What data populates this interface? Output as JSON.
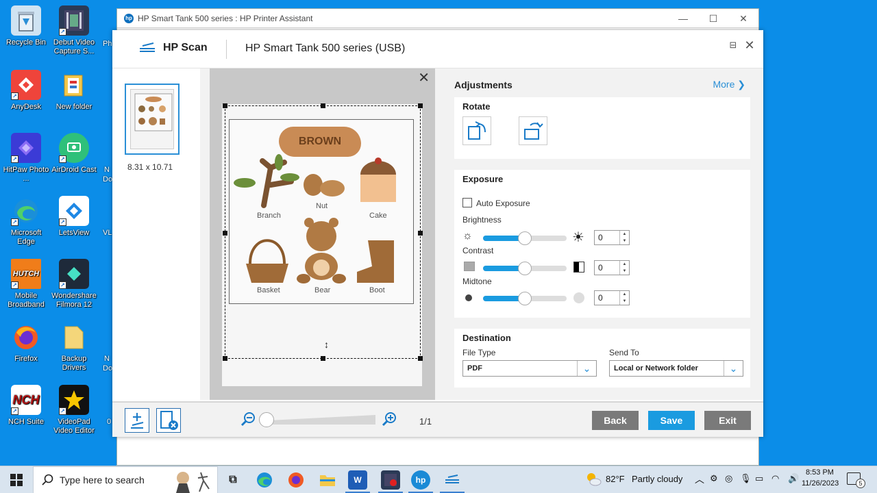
{
  "desktop": {
    "icons": [
      {
        "label": "Recycle Bin",
        "icon": "recycle-bin-icon",
        "color": "#cfe3f2"
      },
      {
        "label": "Debut Video Capture S...",
        "icon": "debut-video-icon",
        "color": "#2b3a56"
      },
      {
        "label": "AnyDesk",
        "icon": "anydesk-icon",
        "color": "#ef443b"
      },
      {
        "label": "New folder",
        "icon": "folder-icon",
        "color": "#f4c84a"
      },
      {
        "label": "HitPaw Photo ...",
        "icon": "hitpaw-icon",
        "color": "#3b3bd6"
      },
      {
        "label": "AirDroid Cast",
        "icon": "airdroid-cast-icon",
        "color": "#2fc07a"
      },
      {
        "label": "Microsoft Edge",
        "icon": "edge-icon",
        "color": "#1b8fd8"
      },
      {
        "label": "LetsView",
        "icon": "letsview-icon",
        "color": "#ffffff"
      },
      {
        "label": "Mobile Broadband",
        "icon": "hutch-icon",
        "color": "#f07d1a"
      },
      {
        "label": "Wondershare Filmora 12",
        "icon": "filmora-icon",
        "color": "#1e2a3a"
      },
      {
        "label": "Firefox",
        "icon": "firefox-icon",
        "color": "#f05a24"
      },
      {
        "label": "Backup Drivers",
        "icon": "folder-icon",
        "color": "#f4d67a"
      },
      {
        "label": "NCH Suite",
        "icon": "nch-icon",
        "color": "#ffffff"
      },
      {
        "label": "VideoPad Video Editor",
        "icon": "videopad-icon",
        "color": "#111111"
      }
    ],
    "partial_labels": [
      "Ph",
      "N",
      "Do",
      "VL",
      "N",
      "Do",
      "0"
    ]
  },
  "back_window": {
    "title": "HP Smart Tank 500 series : HP Printer Assistant",
    "controls": [
      "—",
      "☐",
      "✕"
    ]
  },
  "scan_window": {
    "app_name": "HP Scan",
    "device": "HP Smart Tank 500 series (USB)",
    "thumbnail_size": "8.31  x  10.71",
    "worksheet": {
      "banner": "BROWN",
      "items": [
        "Branch",
        "Nut",
        "Cake",
        "Basket",
        "Bear",
        "Boot"
      ]
    },
    "adjustments": {
      "title": "Adjustments",
      "more": "More",
      "rotate": {
        "title": "Rotate"
      },
      "exposure": {
        "title": "Exposure",
        "auto_label": "Auto Exposure",
        "auto_checked": false,
        "brightness": {
          "label": "Brightness",
          "value": "0",
          "level": 0.5
        },
        "contrast": {
          "label": "Contrast",
          "value": "0",
          "level": 0.5
        },
        "midtone": {
          "label": "Midtone",
          "value": "0",
          "level": 0.5
        }
      },
      "destination": {
        "title": "Destination",
        "file_type_label": "File Type",
        "file_type_value": "PDF",
        "send_to_label": "Send To",
        "send_to_value": "Local or Network folder"
      }
    },
    "bottom": {
      "page_count": "1/1",
      "back": "Back",
      "save": "Save",
      "exit": "Exit",
      "back_color": "#7a7a7a",
      "save_color": "#1a9be0",
      "exit_color": "#7a7a7a"
    }
  },
  "taskbar": {
    "search_placeholder": "Type here to search",
    "weather_temp": "82°F",
    "weather_desc": "Partly cloudy",
    "time": "8:53 PM",
    "date": "11/26/2023",
    "notification_count": "5"
  }
}
